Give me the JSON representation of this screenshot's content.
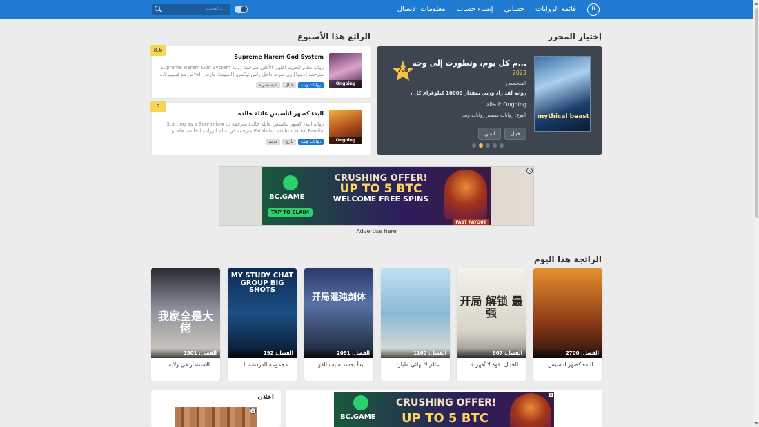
{
  "nav": {
    "links": [
      "قائمة الروايات",
      "حسابي",
      "إنشاء حساب",
      "معلومات الإتصال"
    ],
    "logo": "R",
    "search_placeholder": "البحث..."
  },
  "editor_pick": {
    "heading": "إختيار المحرر",
    "title": "...م كل يوم، وتطورت إلى وحش أسطوري",
    "year": "2023",
    "rank_label": "المتخصص",
    "description": "رواية لقد زاد وزني بمقدار 10000 كيلوغرام كل يوم، وتطورت إلى",
    "status": "Ongoing :الحالة",
    "type": "النوع: روايات سيمبر روايات ويب",
    "rating": "7.8",
    "chips": [
      "خيال",
      "الفئن"
    ],
    "cover_text": "mythical beast",
    "dots": 5,
    "active_dot": 3
  },
  "weekly": {
    "heading": "الرائع هذا الأسبوع",
    "items": [
      {
        "title": "Supreme Harem God System",
        "desc": "رواية نظام الحريم الإلهي الأعلى مترجمة رواية Supreme Harem God System مترجمة [دينغ!] رن صوت داخل رأس توكس، [المهمة: مارس الج*س مع فيليبيرتا...",
        "tags": [
          "روايات ويب",
          "خيال",
          "شبه بشرية"
        ],
        "score": "8.6",
        "badge": "Ongoing",
        "bg": "linear-gradient(160deg, #6c3a6b, #d9a2c9 50%, #3b1f45)"
      },
      {
        "title": "البدء كصهر لتأسيس عائلة خالدة",
        "desc": "رواية البدء كصهر لتأسيس عائلة خالدة مترجمة Starting as a Son-in-law to Establish an Immortal Family مترجمة في عالم الزراعة الخالدة، جاء لو...",
        "tags": [
          "روايات ويب",
          "تاريخ",
          "حريم"
        ],
        "score": "8",
        "badge": "Ongoing",
        "bg": "linear-gradient(160deg, #f1b43f, #b5501f 50%, #3b1a14)"
      }
    ]
  },
  "ad": {
    "brand": "BC.GAME",
    "claim": "TAP TO CLAIM",
    "line1": "CRUSHING OFFER!",
    "line2": "UP TO 5 BTC",
    "line3": "WELCOME FREE SPINS",
    "payout": "FAST PAYOUT",
    "advertise": "Advertise here",
    "close": "x"
  },
  "today": {
    "heading": "الرائجة هذا اليوم",
    "items": [
      {
        "chapter": "الفصل: 2700",
        "title": "البدء كصهر لتأسيس...",
        "bg": "linear-gradient(180deg, #e4912e, #8c3a16 60%, #2a140c)",
        "imgtext": ""
      },
      {
        "chapter": "الفصل: 867",
        "title": "الخيال: قوة لا تُقهر فـ...",
        "bg": "linear-gradient(180deg, #f4f1ea, #d9d4c8 70%, #8c8a84)",
        "imgtext": "开局 解锁 最强"
      },
      {
        "chapter": "الفصل: 1160",
        "title": "عالم لا نهائي مليارا...",
        "bg": "linear-gradient(180deg, #bfe0f2, #8ab9d8 50%, #e6e0d2)",
        "imgtext": ""
      },
      {
        "chapter": "الفصل: 2081",
        "title": "ابدأ بجسد سيف الفو...",
        "bg": "linear-gradient(180deg, #2a3a6a, #5872a8 40%, #1a2033)",
        "imgtext": "开局混沌剑体"
      },
      {
        "chapter": "الفصل: 192",
        "title": "مجموعة الدردشة الـ...",
        "bg": "linear-gradient(180deg, #0d2a52, #1c4f86 50%, #081629)",
        "imgtext": "MY STUDY CHAT GROUP BIG SHOTS"
      },
      {
        "chapter": "الفصل: 1501",
        "title": "الاستثمار في ولاية ...",
        "bg": "linear-gradient(180deg, #2a2a33, #8a8f9a 45%, #d6d0c4)",
        "imgtext": "我家全是大佬"
      }
    ]
  },
  "bottom": {
    "ad_label": "اعلان"
  },
  "colors": {
    "accent": "#1f7ad1",
    "star": "#f6c343",
    "background": "#ececec"
  }
}
